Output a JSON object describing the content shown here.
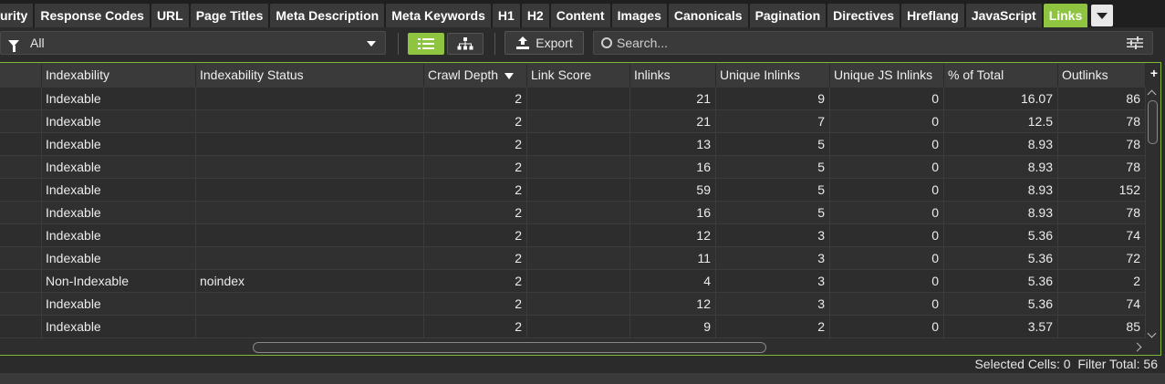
{
  "tabs": [
    {
      "label": "urity"
    },
    {
      "label": "Response Codes"
    },
    {
      "label": "URL"
    },
    {
      "label": "Page Titles"
    },
    {
      "label": "Meta Description"
    },
    {
      "label": "Meta Keywords"
    },
    {
      "label": "H1"
    },
    {
      "label": "H2"
    },
    {
      "label": "Content"
    },
    {
      "label": "Images"
    },
    {
      "label": "Canonicals"
    },
    {
      "label": "Pagination"
    },
    {
      "label": "Directives"
    },
    {
      "label": "Hreflang"
    },
    {
      "label": "JavaScript"
    },
    {
      "label": "Links",
      "active": true
    }
  ],
  "toolbar": {
    "filter_value": "All",
    "export_label": "Export",
    "search_placeholder": "Search..."
  },
  "table": {
    "columns": [
      "Indexability",
      "Indexability Status",
      "Crawl Depth",
      "Link Score",
      "Inlinks",
      "Unique Inlinks",
      "Unique JS Inlinks",
      "% of Total",
      "Outlinks"
    ],
    "sorted_column": "Crawl Depth",
    "rows": [
      [
        "Indexable",
        "",
        "2",
        "",
        "21",
        "9",
        "0",
        "16.07",
        "86"
      ],
      [
        "Indexable",
        "",
        "2",
        "",
        "21",
        "7",
        "0",
        "12.5",
        "78"
      ],
      [
        "Indexable",
        "",
        "2",
        "",
        "13",
        "5",
        "0",
        "8.93",
        "78"
      ],
      [
        "Indexable",
        "",
        "2",
        "",
        "16",
        "5",
        "0",
        "8.93",
        "78"
      ],
      [
        "Indexable",
        "",
        "2",
        "",
        "59",
        "5",
        "0",
        "8.93",
        "152"
      ],
      [
        "Indexable",
        "",
        "2",
        "",
        "16",
        "5",
        "0",
        "8.93",
        "78"
      ],
      [
        "Indexable",
        "",
        "2",
        "",
        "12",
        "3",
        "0",
        "5.36",
        "74"
      ],
      [
        "Indexable",
        "",
        "2",
        "",
        "11",
        "3",
        "0",
        "5.36",
        "72"
      ],
      [
        "Non-Indexable",
        "noindex",
        "2",
        "",
        "4",
        "3",
        "0",
        "5.36",
        "2"
      ],
      [
        "Indexable",
        "",
        "2",
        "",
        "12",
        "3",
        "0",
        "5.36",
        "74"
      ],
      [
        "Indexable",
        "",
        "2",
        "",
        "9",
        "2",
        "0",
        "3.57",
        "85"
      ]
    ]
  },
  "status": {
    "selected_label": "Selected Cells:",
    "selected_value": "0",
    "filter_label": "Filter Total:",
    "filter_value": "56"
  },
  "colors": {
    "accent": "#8ec43f",
    "background": "#2b2b2b",
    "tab_bg": "#3a3a3a"
  }
}
